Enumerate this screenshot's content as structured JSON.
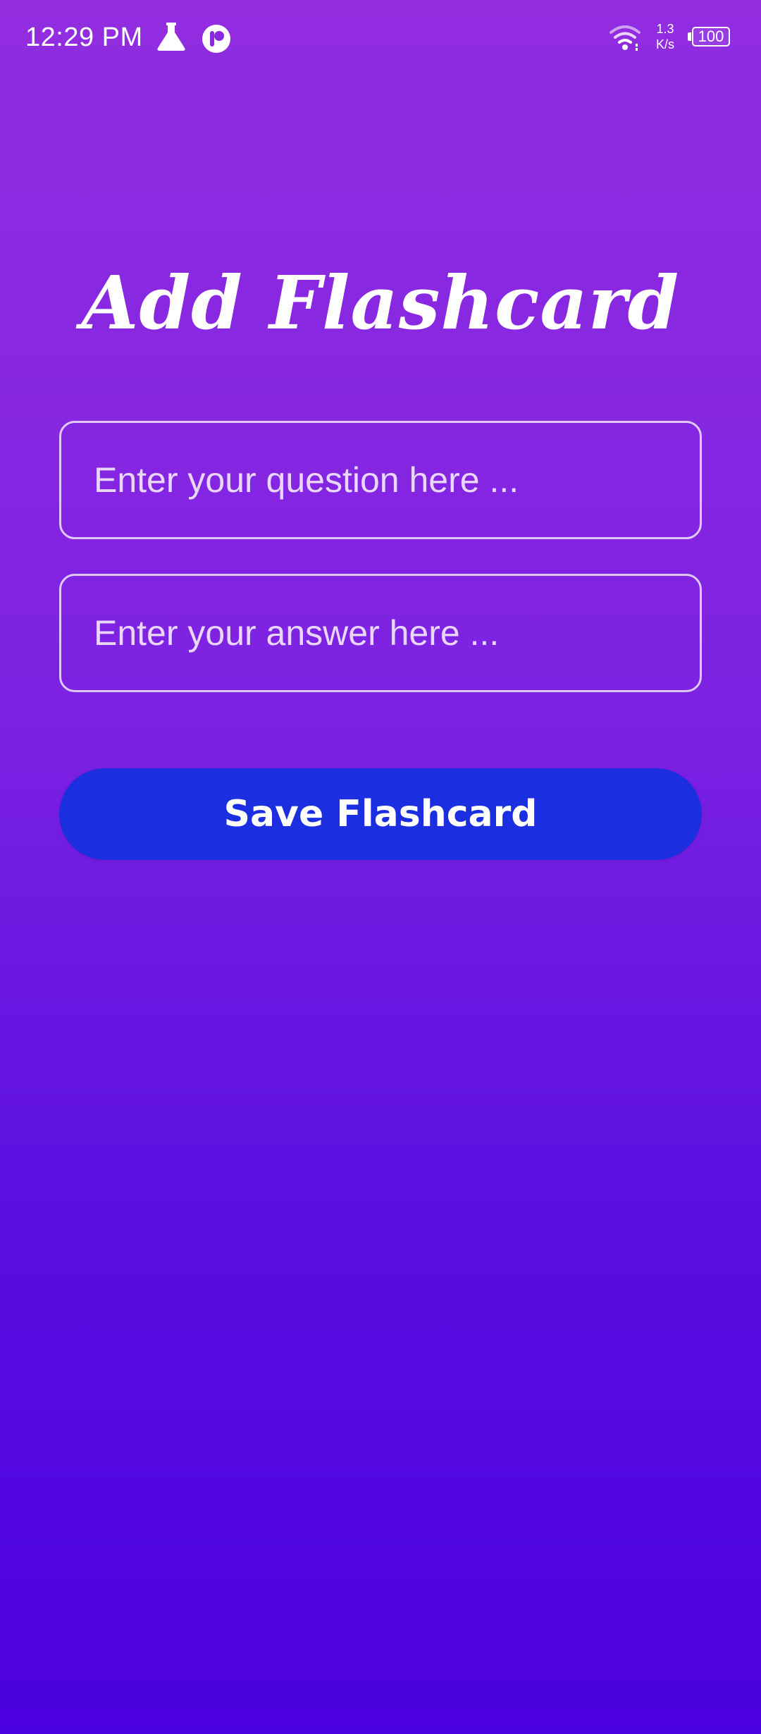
{
  "status_bar": {
    "time": "12:29 PM",
    "network_speed_value": "1.3",
    "network_speed_unit": "K/s",
    "battery_level": "100",
    "icons": [
      "flask-icon",
      "app-notification-icon",
      "wifi-icon",
      "battery-icon"
    ]
  },
  "page": {
    "title": "Add Flashcard"
  },
  "form": {
    "question_placeholder": "Enter your question here ...",
    "question_value": "",
    "answer_placeholder": "Enter your answer here ...",
    "answer_value": "",
    "save_label": "Save Flashcard"
  },
  "colors": {
    "background_top": "#922de0",
    "background_bottom": "#4b00df",
    "button": "#1b2ee0",
    "text": "#ffffff"
  }
}
